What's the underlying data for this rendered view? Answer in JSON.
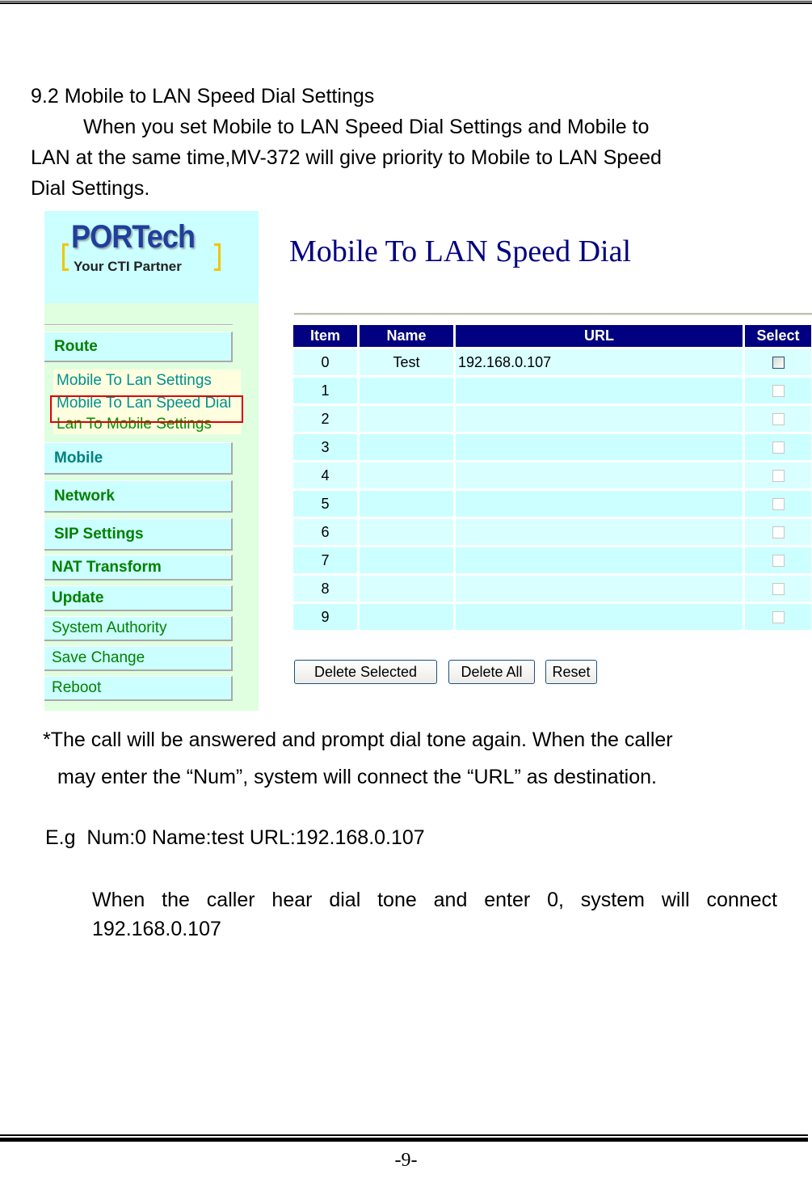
{
  "document": {
    "section_title": "9.2 Mobile to LAN Speed Dial Settings",
    "intro_lines": [
      "When you set Mobile to LAN Speed Dial Settings and Mobile to",
      "LAN at the same time,MV-372 will give priority to Mobile to LAN Speed",
      "Dial Settings."
    ],
    "note_lines": [
      "*The call will be answered and prompt dial tone again. When the caller",
      "may enter the “Num”, system will connect the “URL” as destination."
    ],
    "example_line": "E.g  Num:0 Name:test URL:192.168.0.107",
    "when_lines": [
      "When the caller hear dial tone and enter 0, system will connect",
      "192.168.0.107"
    ],
    "page_number": "-9-"
  },
  "screenshot": {
    "logo": {
      "brand": "PORTech",
      "tagline": "Your CTI Partner",
      "icon": "portech-logo"
    },
    "sidebar": {
      "items": [
        {
          "label": "Route",
          "style": "bold"
        },
        {
          "label": "Mobile To Lan Settings",
          "style": "sub"
        },
        {
          "label": "Mobile To Lan Speed Dial",
          "style": "sub",
          "highlighted": true
        },
        {
          "label": "Lan To Mobile Settings",
          "style": "sub"
        },
        {
          "label": "Mobile",
          "style": "bold"
        },
        {
          "label": "Network",
          "style": "bold"
        },
        {
          "label": "SIP Settings",
          "style": "bold"
        },
        {
          "label": "NAT Transform",
          "style": "bold"
        },
        {
          "label": "Update",
          "style": "bold"
        },
        {
          "label": "System Authority",
          "style": "normal"
        },
        {
          "label": "Save Change",
          "style": "normal"
        },
        {
          "label": "Reboot",
          "style": "normal"
        }
      ]
    },
    "page_title": "Mobile To LAN Speed Dial",
    "table": {
      "columns": [
        "Item",
        "Name",
        "URL",
        "Select"
      ],
      "rows": [
        {
          "item": "0",
          "name": "Test",
          "url": "192.168.0.107",
          "selected": false
        },
        {
          "item": "1",
          "name": "",
          "url": "",
          "selected": false
        },
        {
          "item": "2",
          "name": "",
          "url": "",
          "selected": false
        },
        {
          "item": "3",
          "name": "",
          "url": "",
          "selected": false
        },
        {
          "item": "4",
          "name": "",
          "url": "",
          "selected": false
        },
        {
          "item": "5",
          "name": "",
          "url": "",
          "selected": false
        },
        {
          "item": "6",
          "name": "",
          "url": "",
          "selected": false
        },
        {
          "item": "7",
          "name": "",
          "url": "",
          "selected": false
        },
        {
          "item": "8",
          "name": "",
          "url": "",
          "selected": false
        },
        {
          "item": "9",
          "name": "",
          "url": "",
          "selected": false
        }
      ]
    },
    "buttons": {
      "delete_selected": "Delete Selected",
      "delete_all": "Delete All",
      "reset": "Reset"
    },
    "colors": {
      "header_bg": "#000080",
      "title": "#000080",
      "sidebar_bg": "#e0ffe0",
      "nav_bg": "#ccffff",
      "nav_text": "#008000",
      "highlight": "#e00000"
    }
  }
}
